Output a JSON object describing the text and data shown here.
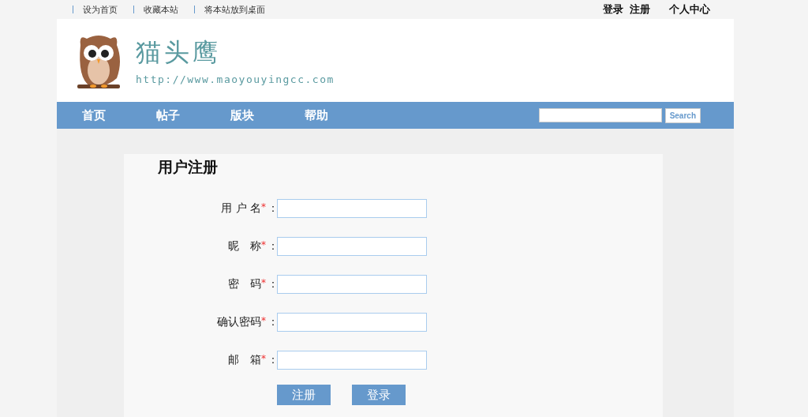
{
  "top_links": [
    "设为首页",
    "收藏本站",
    "将本站放到桌面"
  ],
  "account_links": [
    "登录",
    "注册"
  ],
  "user_center": "个人中心",
  "site": {
    "name": "猫头鹰",
    "url": "http://www.maoyouyingcc.com"
  },
  "nav": [
    "首页",
    "帖子",
    "版块",
    "帮助"
  ],
  "search": {
    "button": "Search"
  },
  "form": {
    "title": "用户注册",
    "fields": [
      {
        "label": "用 户 名",
        "required": true,
        "colon": "："
      },
      {
        "label": "昵　称",
        "required": true,
        "colon": "："
      },
      {
        "label": "密　码",
        "required": true,
        "colon": "："
      },
      {
        "label": "确认密码",
        "required": true,
        "colon": "："
      },
      {
        "label": "邮　箱",
        "required": true,
        "colon": "："
      }
    ],
    "required_mark": "*",
    "buttons": [
      "注册",
      "登录"
    ]
  }
}
